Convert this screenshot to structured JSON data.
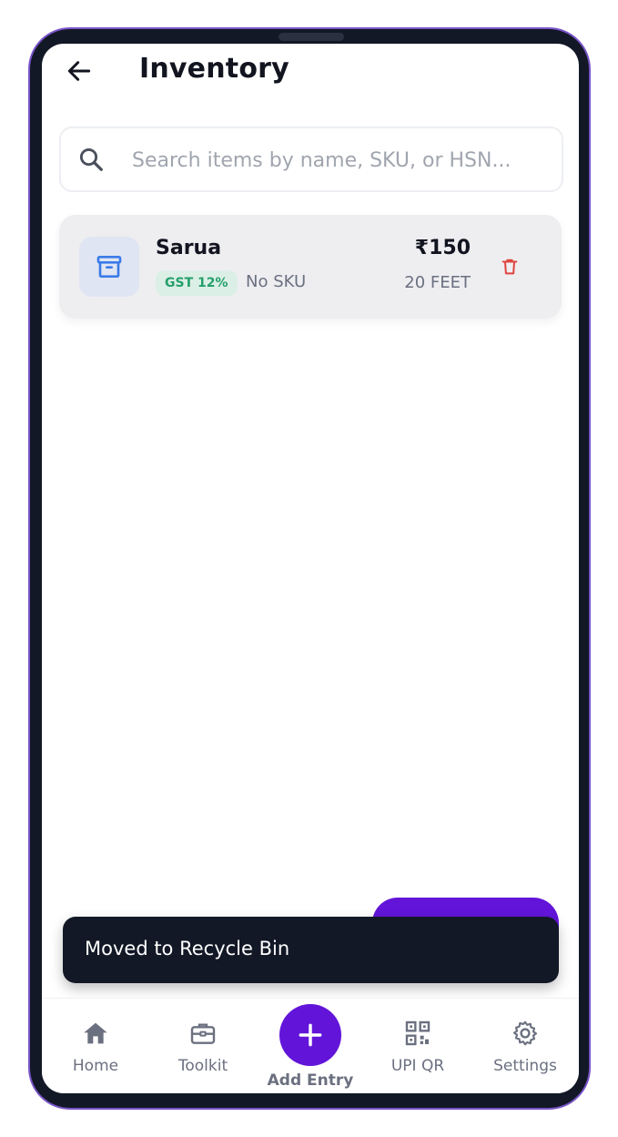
{
  "header": {
    "title": "Inventory",
    "back_icon": "arrow-left-icon"
  },
  "search": {
    "placeholder": "Search items by name, SKU, or HSN...",
    "value": "",
    "icon": "search-icon"
  },
  "items": [
    {
      "name": "Sarua",
      "gst_badge": "GST 12%",
      "sku": "No SKU",
      "price": "₹150",
      "quantity": "20 FEET",
      "icon": "archive-box-icon",
      "delete_icon": "trash-icon"
    }
  ],
  "snackbar": {
    "message": "Moved to Recycle Bin"
  },
  "bottom_nav": {
    "items": [
      {
        "label": "Home",
        "icon": "home-icon"
      },
      {
        "label": "Toolkit",
        "icon": "toolkit-briefcase-icon"
      },
      {
        "label": "Add Entry",
        "icon": "plus-icon"
      },
      {
        "label": "UPI QR",
        "icon": "qr-code-icon"
      },
      {
        "label": "Settings",
        "icon": "gear-icon"
      }
    ]
  },
  "colors": {
    "accent": "#6215d9",
    "dark": "#121826",
    "delete": "#e0453f",
    "gst_badge_bg": "#dcefe6",
    "gst_badge_text": "#24a06a",
    "item_icon": "#3b7be8"
  }
}
